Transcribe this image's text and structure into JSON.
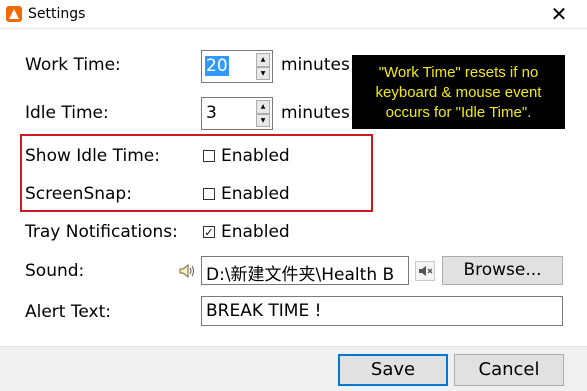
{
  "window": {
    "title": "Settings",
    "close_glyph": "✕"
  },
  "work_time": {
    "label": "Work Time:",
    "value": "20",
    "unit": "minutes"
  },
  "idle_time": {
    "label": "Idle Time:",
    "value": "3",
    "unit": "minutes"
  },
  "tooltip": {
    "lines": [
      "\"Work Time\" resets if no",
      "keyboard & mouse event",
      "occurs for \"Idle Time\"."
    ]
  },
  "show_idle_time": {
    "label": "Show Idle Time:",
    "checkbox_label": "Enabled",
    "checked": false
  },
  "screensnap": {
    "label": "ScreenSnap:",
    "checkbox_label": "Enabled",
    "checked": false
  },
  "tray_notifications": {
    "label": "Tray Notifications:",
    "checkbox_label": "Enabled",
    "checked": true
  },
  "sound": {
    "label": "Sound:",
    "value": "D:\\新建文件夹\\Health B",
    "browse_label": "Browse..."
  },
  "alert_text": {
    "label": "Alert Text:",
    "value": "BREAK TIME !"
  },
  "footer": {
    "save_label": "Save",
    "cancel_label": "Cancel"
  },
  "colors": {
    "highlight": "#cc1a22",
    "tooltip_text": "#f4ea12",
    "selection": "#3399ff",
    "accent": "#0078d7"
  }
}
